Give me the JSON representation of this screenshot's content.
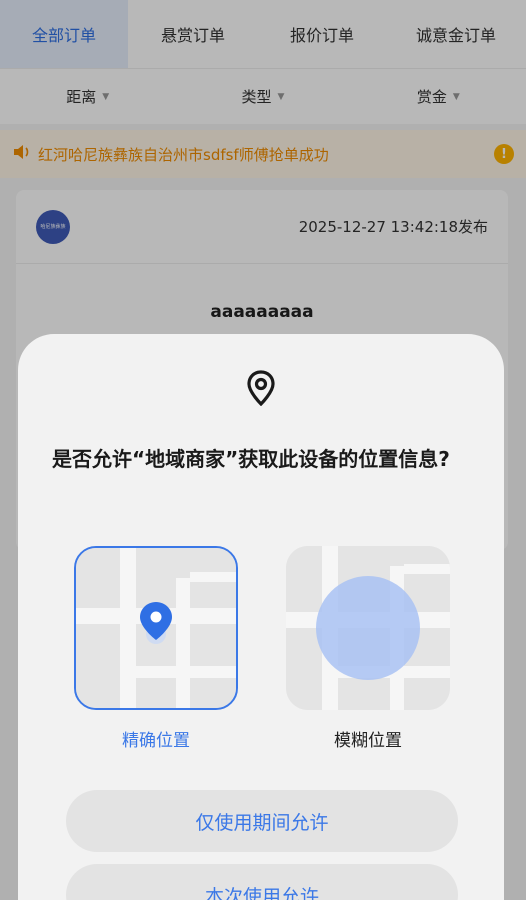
{
  "tabs": [
    {
      "label": "全部订单"
    },
    {
      "label": "悬赏订单"
    },
    {
      "label": "报价订单"
    },
    {
      "label": "诚意金订单"
    }
  ],
  "filters": [
    {
      "label": "距离"
    },
    {
      "label": "类型"
    },
    {
      "label": "赏金"
    }
  ],
  "notice": {
    "message": "红河哈尼族彝族自治州市sdfsf师傅抢单成功",
    "icon": "speaker-icon",
    "info_icon": "info-icon"
  },
  "order_card": {
    "logo_text": "哈尼族彝族",
    "published": "2025-12-27 13:42:18发布",
    "title": "aaaaaaaaa"
  },
  "dialog": {
    "icon": "location-pin-icon",
    "question": "是否允许“地域商家”获取此设备的位置信息?",
    "options": [
      {
        "label": "精确位置",
        "selected": true
      },
      {
        "label": "模糊位置",
        "selected": false
      }
    ],
    "buttons": [
      {
        "label": "仅使用期间允许"
      },
      {
        "label": "本次使用允许"
      }
    ]
  },
  "colors": {
    "accent": "#3b78e7",
    "notice": "#f08c00"
  }
}
